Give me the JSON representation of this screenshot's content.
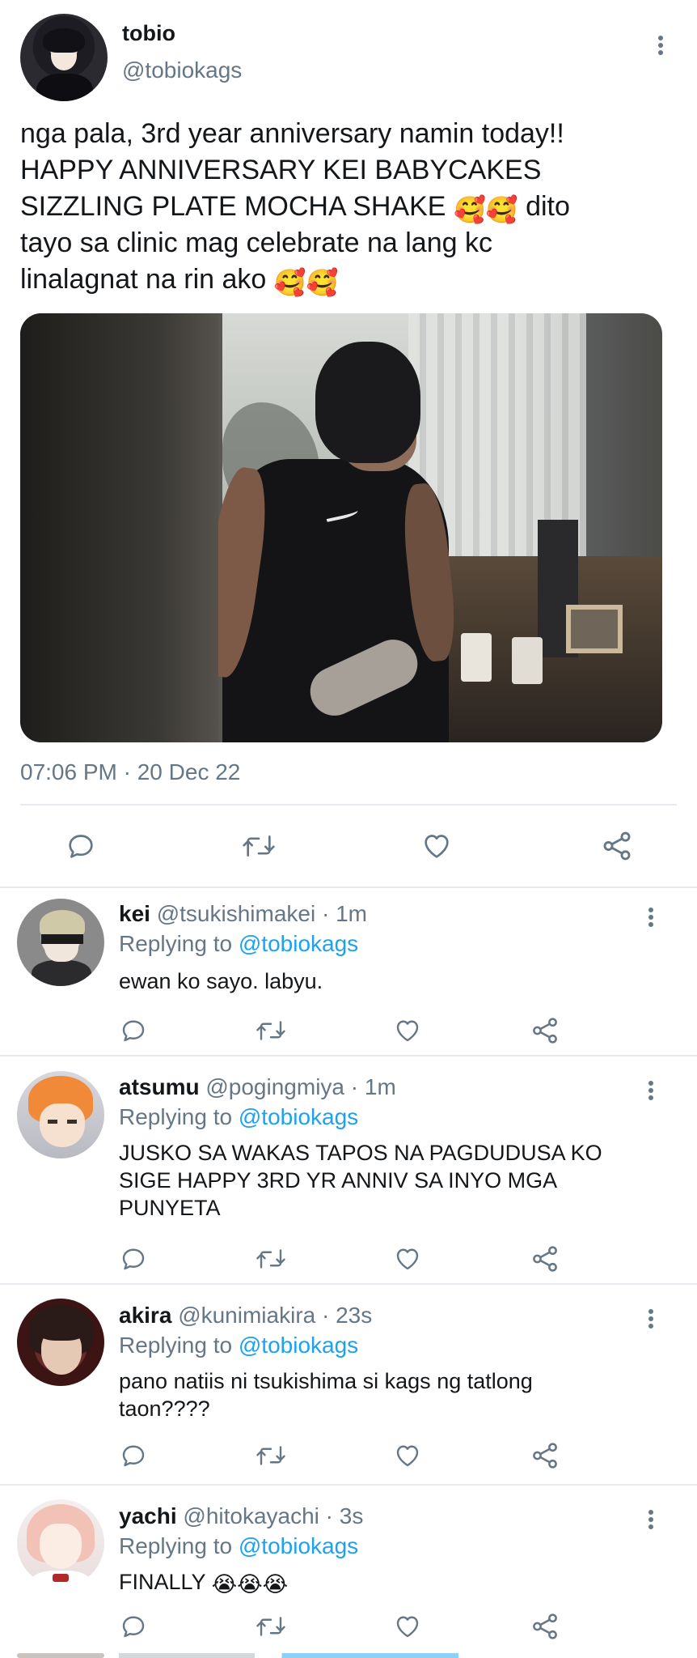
{
  "main_tweet": {
    "name": "tobio",
    "handle": "@tobiokags",
    "text_line1": "nga pala, 3rd year anniversary namin today!!",
    "text_line2": "HAPPY ANNIVERSARY KEI BABYCAKES",
    "text_line3a": "SIZZLING PLATE MOCHA SHAKE ",
    "text_line3_emoji": "🥰🥰",
    "text_line3b": " dito",
    "text_line4": "tayo sa clinic mag celebrate na lang kc",
    "text_line5a": "linalagnat na rin ako ",
    "text_line5_emoji": "🥰🥰",
    "timestamp": "07:06 PM · 20 Dec 22"
  },
  "actions": {
    "reply_icon": "reply-icon",
    "retweet_icon": "retweet-icon",
    "like_icon": "heart-icon",
    "share_icon": "share-icon"
  },
  "replies": [
    {
      "name": "kei",
      "handle": "@tsukishimakei",
      "time": " · 1m",
      "replying_prefix": "Replying to ",
      "replying_to": "@tobiokags",
      "text": "ewan ko sayo. labyu."
    },
    {
      "name": "atsumu",
      "handle": "@pogingmiya",
      "time": " · 1m",
      "replying_prefix": "Replying to ",
      "replying_to": "@tobiokags",
      "text_line1": "JUSKO SA WAKAS TAPOS NA PAGDUDUSA KO",
      "text_line2": "SIGE HAPPY 3RD YR ANNIV SA INYO MGA",
      "text_line3": "PUNYETA"
    },
    {
      "name": "akira",
      "handle": "@kunimiakira",
      "time": " · 23s",
      "replying_prefix": "Replying to ",
      "replying_to": "@tobiokags",
      "text_line1": "pano natiis ni tsukishima si kags ng tatlong",
      "text_line2": "taon????"
    },
    {
      "name": "yachi",
      "handle": "@hitokayachi",
      "time": " · 3s",
      "replying_prefix": "Replying to ",
      "replying_to": "@tobiokags",
      "text": "FINALLY ",
      "text_emoji": "😭😭😭"
    }
  ],
  "colors": {
    "text": "#14171a",
    "secondary": "#657786",
    "link": "#1da1f2",
    "divider": "#e6ecf0"
  }
}
